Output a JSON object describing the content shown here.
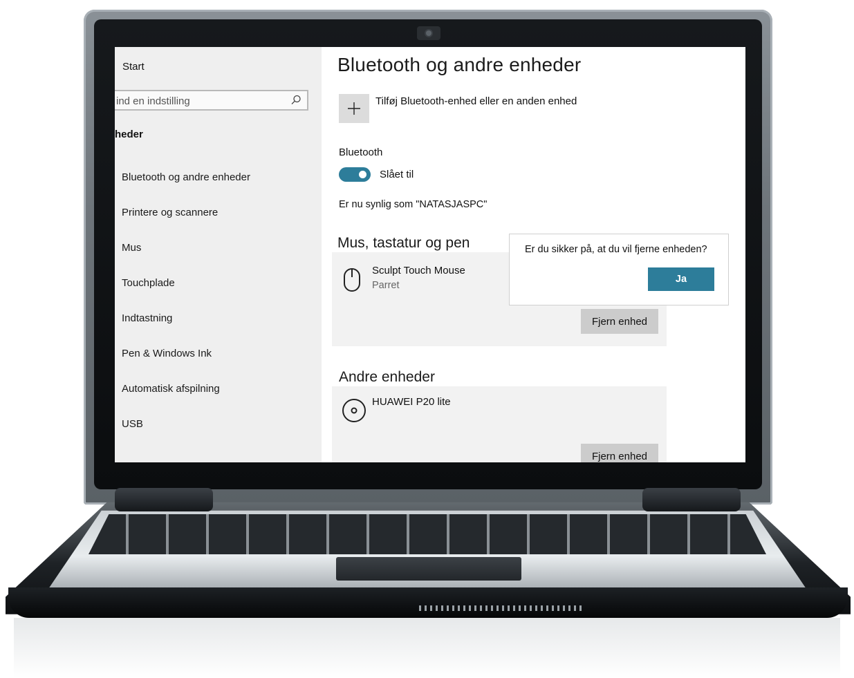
{
  "settings": {
    "sidebar": {
      "home_label": "Start",
      "search_placeholder": "ind en indstilling",
      "category_label": "heder",
      "items": [
        {
          "label": "Bluetooth og andre enheder"
        },
        {
          "label": "Printere og scannere"
        },
        {
          "label": "Mus"
        },
        {
          "label": "Touchplade"
        },
        {
          "label": "Indtastning"
        },
        {
          "label": "Pen & Windows Ink"
        },
        {
          "label": "Automatisk afspilning"
        },
        {
          "label": "USB"
        }
      ]
    },
    "main": {
      "title": "Bluetooth og andre enheder",
      "add_device_label": "Tilføj Bluetooth-enhed eller en anden enhed",
      "bluetooth_label": "Bluetooth",
      "bluetooth_state": "Slået til",
      "bluetooth_on": true,
      "discoverable_text": "Er nu synlig som \"NATASJASPC\"",
      "section_mouse": {
        "heading": "Mus, tastatur og pen",
        "device_name": "Sculpt Touch Mouse",
        "device_status": "Parret",
        "remove_label": "Fjern enhed"
      },
      "section_other": {
        "heading": "Andre enheder",
        "device_name": "HUAWEI P20 lite",
        "remove_label": "Fjern enhed"
      },
      "confirm_popup": {
        "question": "Er du sikker på, at du vil fjerne enheden?",
        "confirm_label": "Ja"
      }
    }
  },
  "colors": {
    "accent": "#2d7d9a",
    "sidebar_bg": "#efefef",
    "card_bg": "#f2f2f2",
    "button_bg": "#cccccc"
  }
}
